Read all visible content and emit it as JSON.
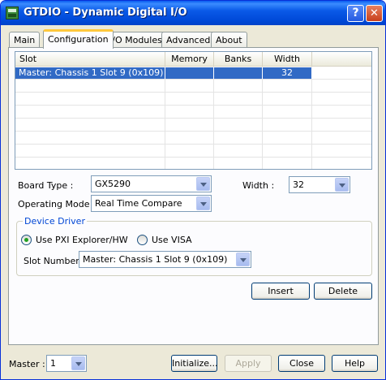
{
  "window": {
    "title": "GTDIO - Dynamic Digital I/O"
  },
  "tabs": [
    {
      "label": "Main"
    },
    {
      "label": "Configuration"
    },
    {
      "label": "I/O Modules"
    },
    {
      "label": "Advanced"
    },
    {
      "label": "About"
    }
  ],
  "active_tab": "Configuration",
  "slot_table": {
    "columns": [
      "Slot",
      "Memory",
      "Banks",
      "Width"
    ],
    "rows": [
      {
        "slot": "Master: Chassis 1 Slot 9 (0x109)",
        "memory": "",
        "banks": "",
        "width": "32",
        "selected": true
      }
    ]
  },
  "config": {
    "board_type_label": "Board Type :",
    "board_type_value": "GX5290",
    "width_label": "Width :",
    "width_value": "32",
    "operating_mode_label": "Operating Mode :",
    "operating_mode_value": "Real Time Compare"
  },
  "device_driver": {
    "legend": "Device Driver",
    "option_pxi": "Use PXI Explorer/HW",
    "option_visa": "Use VISA",
    "selected": "Use PXI Explorer/HW",
    "slot_number_label": "Slot Number :",
    "slot_number_value": "Master: Chassis 1 Slot 9 (0x109)"
  },
  "buttons": {
    "insert": "Insert",
    "delete": "Delete",
    "initialize": "Initialize...",
    "apply": "Apply",
    "close": "Close",
    "help": "Help"
  },
  "footer": {
    "master_label": "Master :",
    "master_value": "1"
  },
  "icons": {
    "app": "app-icon",
    "help": "help-icon",
    "close": "close-icon",
    "dropdown": "chevron-down-icon"
  },
  "colors": {
    "titlebar": "#0a5ae8",
    "selection": "#316ac5",
    "tab_highlight": "#ffc83c",
    "group_legend": "#0046d5"
  }
}
